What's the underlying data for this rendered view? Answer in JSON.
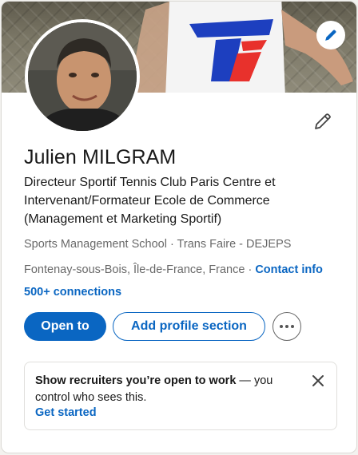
{
  "profile": {
    "name": "Julien MILGRAM",
    "headline": "Directeur Sportif Tennis Club Paris Centre et Intervenant/Formateur Ecole de Commerce (Management et Marketing Sportif)",
    "education": "Sports Management School · Trans Faire - DEJEPS",
    "location": "Fontenay-sous-Bois, Île-de-France, France · ",
    "contact_info": "Contact info",
    "connections": "500+ connections"
  },
  "actions": {
    "open_to": "Open to",
    "add_profile_section": "Add profile section",
    "more_icon": "ellipsis-icon"
  },
  "open_to_work": {
    "text_bold": "Show recruiters you’re open to work",
    "text_rest": " — you control who sees this.",
    "link": "Get started"
  },
  "icons": {
    "banner_edit": "pencil-icon",
    "intro_edit": "pencil-icon",
    "close": "close-icon"
  },
  "colors": {
    "accent": "#0a66c2",
    "card_bg": "#ffffff",
    "page_bg": "#f3f2ef"
  }
}
